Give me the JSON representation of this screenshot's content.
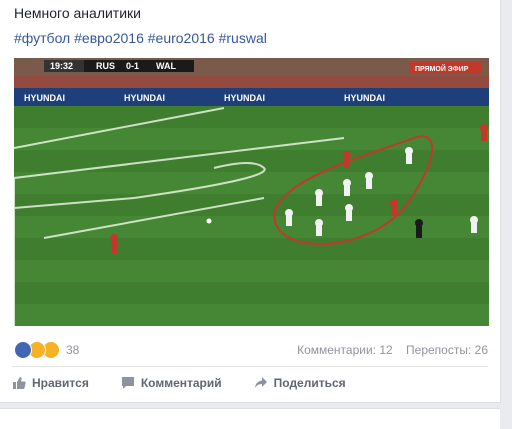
{
  "post": {
    "text": "Немного аналитики",
    "hashtags": [
      "#футбол",
      "#евро2016",
      "#euro2016",
      "#ruswal"
    ]
  },
  "image": {
    "scoreboard": {
      "time": "19:32",
      "home": "RUS",
      "score": "0-1",
      "away": "WAL"
    },
    "live_badge": "ПРЯМОЙ ЭФИР",
    "ad_board": "HYUNDAI"
  },
  "reactions": {
    "icons": [
      "like-icon",
      "haha-icon",
      "wow-icon"
    ],
    "count": "38"
  },
  "stats": {
    "comments": "Комментарии: 12",
    "shares": "Перепосты: 26"
  },
  "actions": {
    "like": "Нравится",
    "comment": "Комментарий",
    "share": "Поделиться"
  },
  "colors": {
    "link": "#365899",
    "muted": "#90949c",
    "pitch": "#3f7d2f",
    "annotation": "#c0392b"
  }
}
